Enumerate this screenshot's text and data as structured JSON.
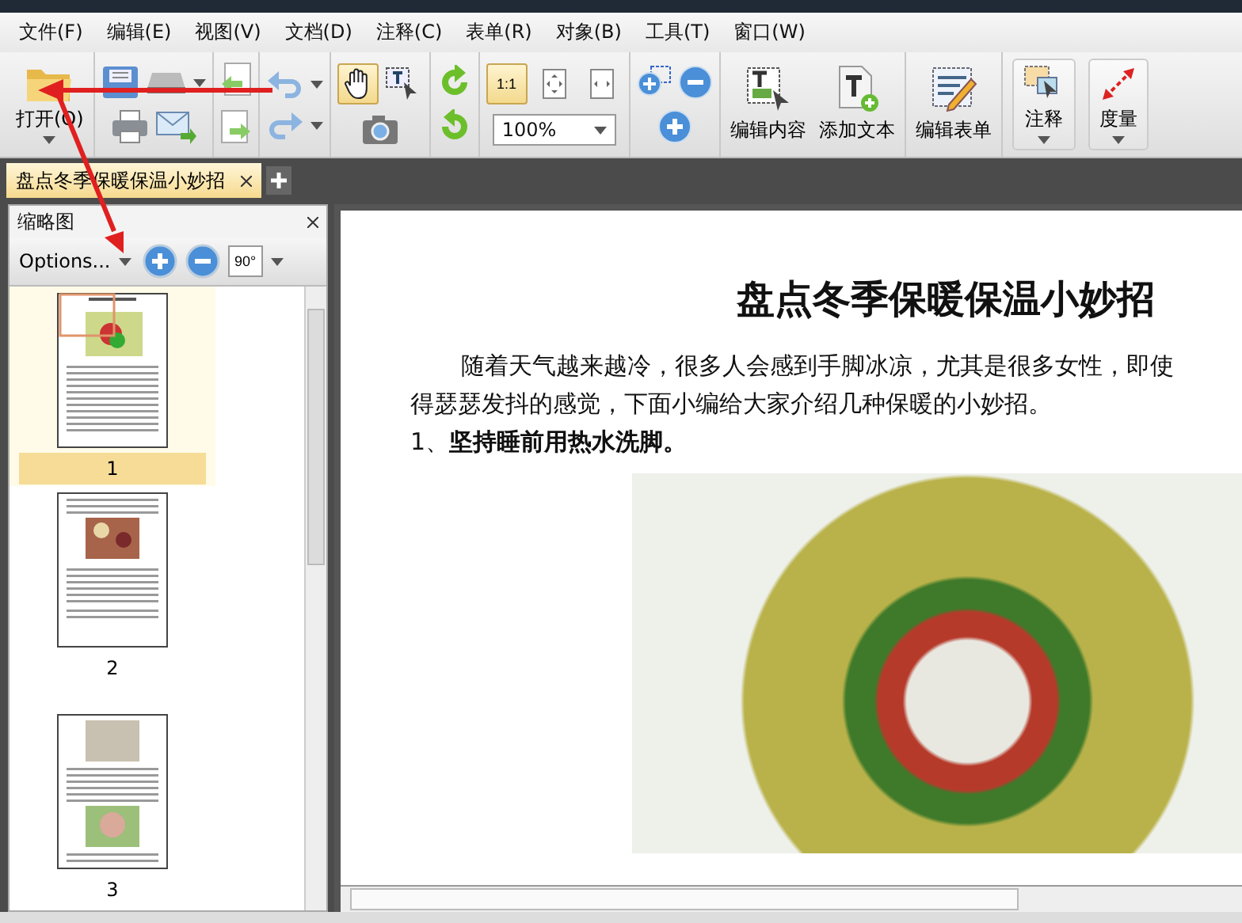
{
  "menu": [
    "文件(F)",
    "编辑(E)",
    "视图(V)",
    "文档(D)",
    "注释(C)",
    "表单(R)",
    "对象(B)",
    "工具(T)",
    "窗口(W)"
  ],
  "toolbar": {
    "open_label": "打开(O)",
    "tools": [
      {
        "kind": "hand",
        "active": true
      },
      {
        "kind": "select-text",
        "active": false
      },
      {
        "kind": "actual-size",
        "active": true,
        "label": "1:1"
      },
      {
        "kind": "fit-page",
        "active": false
      },
      {
        "kind": "fit-width",
        "active": false
      }
    ],
    "zoom_value": "100%",
    "big_buttons": [
      {
        "kind": "edit-content",
        "label": "编辑内容"
      },
      {
        "kind": "add-text",
        "label": "添加文本"
      },
      {
        "kind": "edit-form",
        "label": "编辑表单"
      }
    ],
    "dropdowns": [
      {
        "kind": "comment",
        "label": "注释"
      },
      {
        "kind": "measure",
        "label": "度量"
      }
    ]
  },
  "tabs": [
    {
      "label": "盘点冬季保暖保温小妙招",
      "selected": true
    }
  ],
  "thumbnails": {
    "title": "缩略图",
    "options": "Options...",
    "rotate": "90°",
    "pages": [
      {
        "label": "1",
        "selected": true,
        "kind": "salad"
      },
      {
        "label": "2",
        "selected": false,
        "kind": "bowls"
      },
      {
        "label": "3",
        "selected": false,
        "kind": "two-photos"
      }
    ]
  },
  "document": {
    "title": "盘点冬季保暖保温小妙招",
    "lines": [
      "随着天气越来越冷，很多人会感到手脚冰凉，尤其是很多女性，即使",
      "得瑟瑟发抖的感觉，下面小编给大家介绍几种保暖的小妙招。"
    ],
    "heading": "1、**坚持睡前用热水洗脚。**"
  }
}
